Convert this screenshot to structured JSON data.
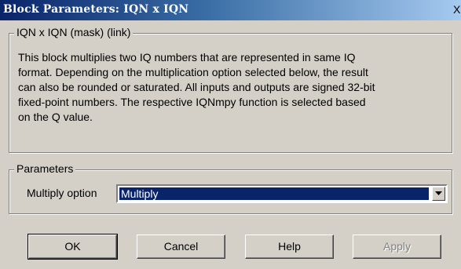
{
  "window": {
    "title": "Block Parameters: IQN x IQN",
    "close_glyph": "X"
  },
  "mask_group": {
    "legend": "IQN x IQN (mask) (link)",
    "description_lines": [
      "This block multiplies two IQ numbers that are represented in same IQ",
      "format. Depending on the multiplication option selected below, the result",
      "can also be rounded or saturated. All inputs and outputs are signed 32-bit",
      "fixed-point numbers. The respective IQNmpy function is selected based",
      "on the Q value."
    ]
  },
  "params_group": {
    "legend": "Parameters",
    "multiply_label": "Multiply option",
    "multiply_value": "Multiply"
  },
  "buttons": {
    "ok": "OK",
    "cancel": "Cancel",
    "help": "Help",
    "apply": "Apply"
  },
  "icons": {
    "combo_arrow": "triangle-down-icon"
  }
}
